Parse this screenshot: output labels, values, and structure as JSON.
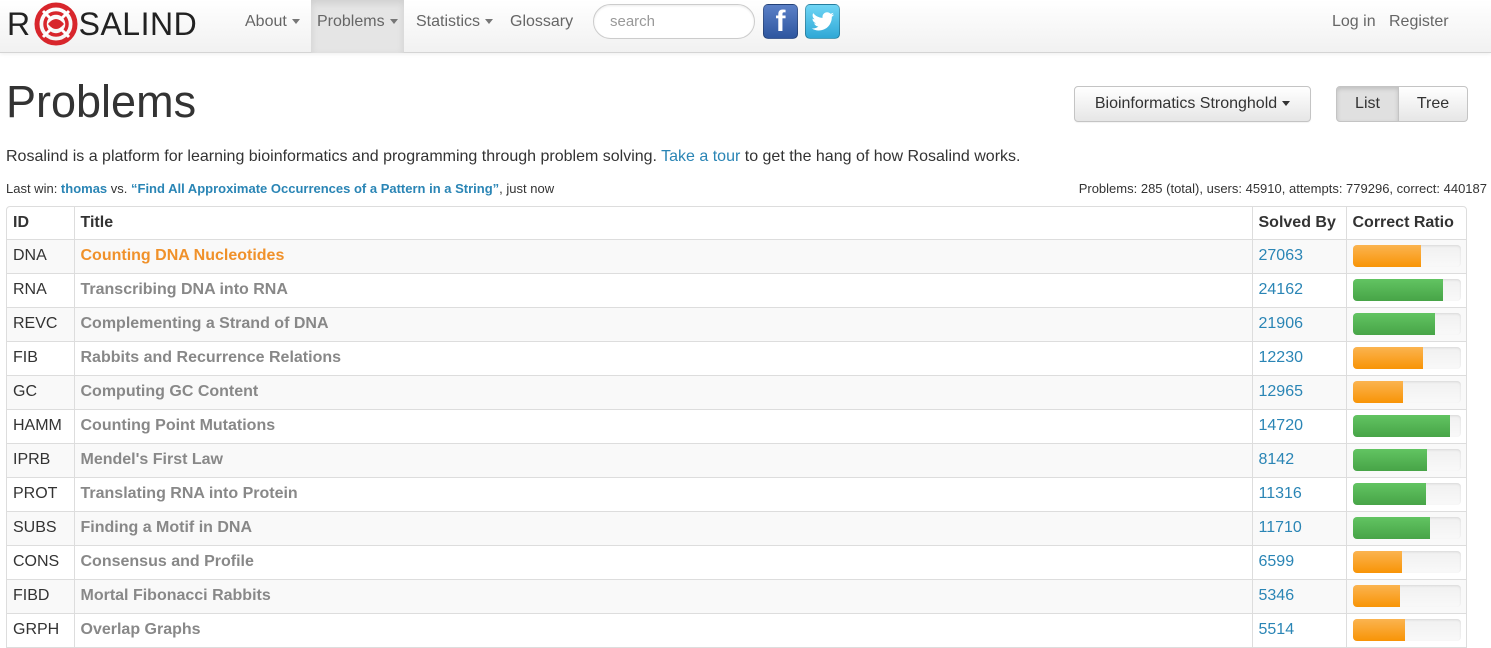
{
  "brand": {
    "left": "R",
    "right": "SALIND"
  },
  "nav": {
    "about": "About",
    "problems": "Problems",
    "statistics": "Statistics",
    "glossary": "Glossary",
    "search_placeholder": "search",
    "facebook": "f",
    "login": "Log in",
    "register": "Register"
  },
  "page": {
    "title": "Problems",
    "dropdown": "Bioinformatics Stronghold",
    "view_list": "List",
    "view_tree": "Tree",
    "intro_before": "Rosalind is a platform for learning bioinformatics and programming through problem solving. ",
    "intro_link": "Take a tour",
    "intro_after": " to get the hang of how Rosalind works.",
    "last_win_prefix": "Last win: ",
    "last_win_user": "thomas",
    "last_win_vs": " vs. ",
    "last_win_problem": "“Find All Approximate Occurrences of a Pattern in a String”",
    "last_win_suffix": ", just now",
    "stats": "Problems: 285 (total), users: 45910, attempts: 779296, correct: 440187"
  },
  "table": {
    "headers": {
      "id": "ID",
      "title": "Title",
      "solved": "Solved By",
      "ratio": "Correct Ratio"
    },
    "rows": [
      {
        "id": "DNA",
        "title": "Counting DNA Nucleotides",
        "solved": "27063",
        "ratio": 0.63,
        "color": "orange",
        "current": true
      },
      {
        "id": "RNA",
        "title": "Transcribing DNA into RNA",
        "solved": "24162",
        "ratio": 0.84,
        "color": "green"
      },
      {
        "id": "REVC",
        "title": "Complementing a Strand of DNA",
        "solved": "21906",
        "ratio": 0.76,
        "color": "green"
      },
      {
        "id": "FIB",
        "title": "Rabbits and Recurrence Relations",
        "solved": "12230",
        "ratio": 0.65,
        "color": "orange"
      },
      {
        "id": "GC",
        "title": "Computing GC Content",
        "solved": "12965",
        "ratio": 0.47,
        "color": "orange"
      },
      {
        "id": "HAMM",
        "title": "Counting Point Mutations",
        "solved": "14720",
        "ratio": 0.9,
        "color": "green"
      },
      {
        "id": "IPRB",
        "title": "Mendel's First Law",
        "solved": "8142",
        "ratio": 0.69,
        "color": "green"
      },
      {
        "id": "PROT",
        "title": "Translating RNA into Protein",
        "solved": "11316",
        "ratio": 0.68,
        "color": "green"
      },
      {
        "id": "SUBS",
        "title": "Finding a Motif in DNA",
        "solved": "11710",
        "ratio": 0.72,
        "color": "green"
      },
      {
        "id": "CONS",
        "title": "Consensus and Profile",
        "solved": "6599",
        "ratio": 0.46,
        "color": "orange"
      },
      {
        "id": "FIBD",
        "title": "Mortal Fibonacci Rabbits",
        "solved": "5346",
        "ratio": 0.44,
        "color": "orange"
      },
      {
        "id": "GRPH",
        "title": "Overlap Graphs",
        "solved": "5514",
        "ratio": 0.49,
        "color": "orange"
      }
    ]
  },
  "colors": {
    "accent_link": "#2a85b5",
    "current_problem": "#f0912a",
    "bar_orange": "#f89406",
    "bar_green": "#47a447",
    "logo_red": "#d8262c"
  },
  "icons": {
    "logo": "rosalind-logo-icon",
    "facebook": "facebook-icon",
    "twitter": "twitter-bird-icon",
    "caret": "caret-down-icon"
  }
}
